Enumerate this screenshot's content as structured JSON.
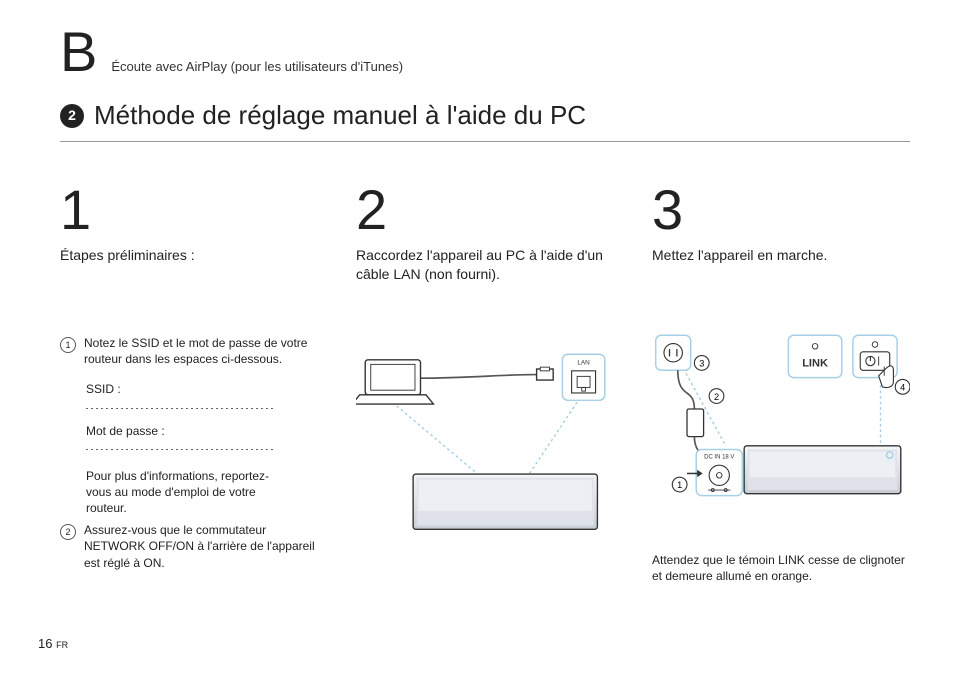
{
  "section_letter": "B",
  "header_sub": "Écoute avec AirPlay (pour les utilisateurs d'iTunes)",
  "step_badge": "2",
  "main_title": "Méthode de réglage manuel à l'aide du PC",
  "columns": {
    "c1": {
      "num": "1",
      "heading": "Étapes préliminaires :",
      "ol": {
        "a1_mark": "1",
        "a1_text": "Notez le SSID et le mot de passe de votre routeur dans les espaces ci-dessous.",
        "a2_mark": "2",
        "a2_text": "Assurez-vous que le commutateur NETWORK OFF/ON à l'arrière de l'appareil est réglé à ON."
      },
      "fields": {
        "ssid_label": "SSID :",
        "pw_label": "Mot de passe :"
      },
      "footnote": "Pour plus d'informations, reportez-vous au mode d'emploi de votre routeur."
    },
    "c2": {
      "num": "2",
      "heading": "Raccordez l'appareil au PC à l'aide d'un câble LAN (non fourni).",
      "lan_label": "LAN"
    },
    "c3": {
      "num": "3",
      "heading": "Mettez l'appareil en marche.",
      "labels": {
        "link": "LINK",
        "dcin": "DC IN 18 V",
        "b1": "1",
        "b2": "2",
        "b3": "3",
        "b4": "4"
      },
      "note": "Attendez que le témoin LINK cesse de clignoter et demeure allumé en orange."
    }
  },
  "page_number": "16",
  "page_suffix": "FR",
  "colors": {
    "callout": "#a7cfe6",
    "stroke": "#333333",
    "speaker_fill": "#d8dbe0"
  }
}
